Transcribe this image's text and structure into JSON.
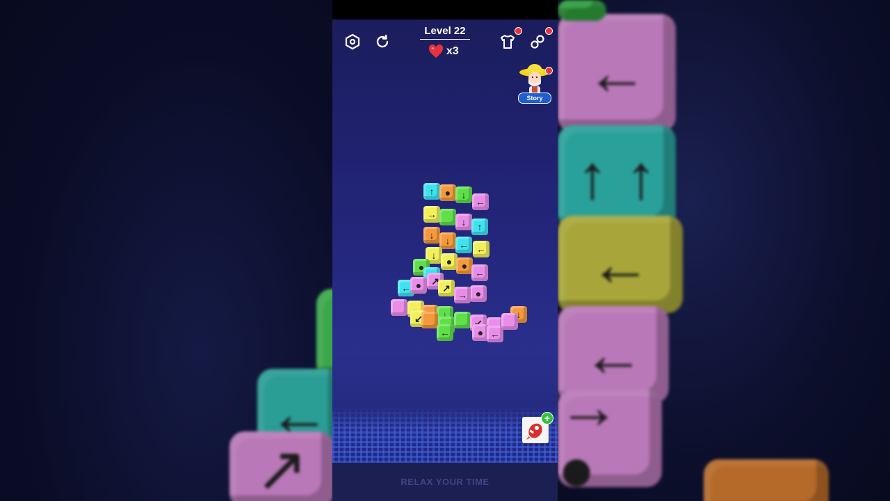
{
  "header": {
    "level_label": "Level 22",
    "lives_text": "x3"
  },
  "story": {
    "label": "Story"
  },
  "footer": {
    "text": "RELAX YOUR TIME"
  },
  "colors": {
    "cyan": "#3fe3f0",
    "orange": "#f59a3c",
    "green": "#5fe04a",
    "pink": "#e88ee9",
    "yellow": "#f2f05a"
  }
}
